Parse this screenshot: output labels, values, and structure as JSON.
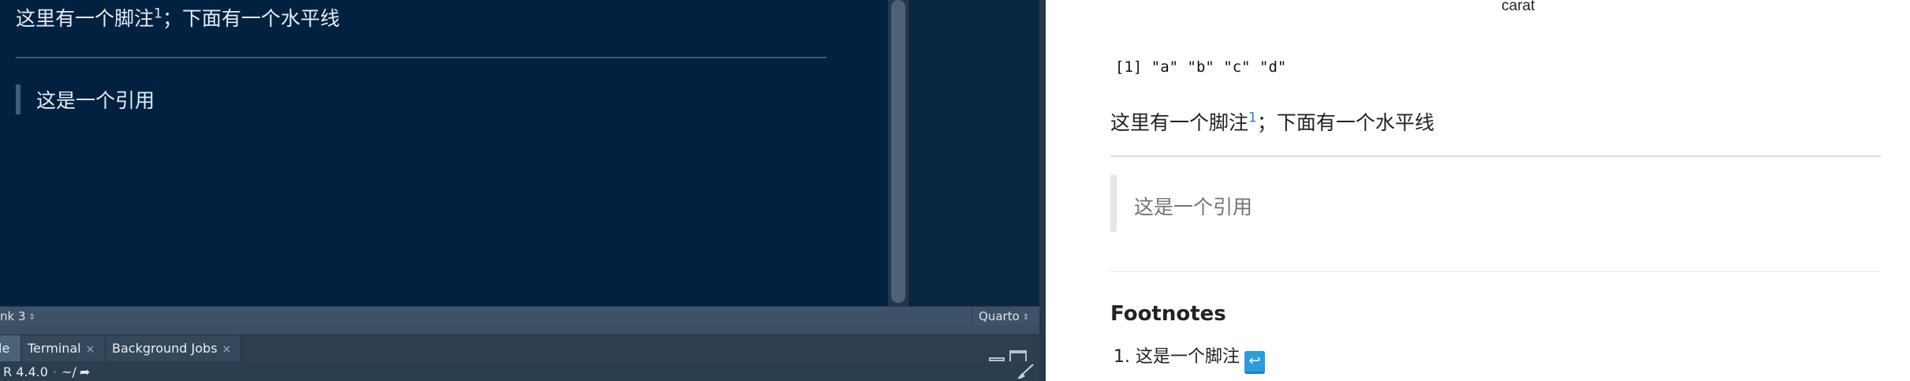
{
  "editor": {
    "line1_text": "这里有一个脚注",
    "line1_sup": "1",
    "line1_after": "；下面有一个水平线",
    "quote_text": "这是一个引用"
  },
  "statusbar": {
    "chunk_label": "nk 3",
    "chunk_updown": "⇕",
    "language": "Quarto",
    "language_updown": "⇕"
  },
  "lower_tabs": {
    "console_label": "le",
    "terminal_label": "Terminal",
    "bgjobs_label": "Background Jobs",
    "close_glyph": "×"
  },
  "console": {
    "r_version": "R 4.4.0",
    "separator": "·",
    "working_dir": "~/"
  },
  "viewer": {
    "carat_label": "carat",
    "code_output": "[1] \"a\" \"b\" \"c\" \"d\"",
    "para_text": "这里有一个脚注",
    "para_sup": "1",
    "para_after": "；下面有一个水平线",
    "quote_text": "这是一个引用",
    "footnotes_title": "Footnotes",
    "footnote_number": "1.",
    "footnote_text": "这是一个脚注",
    "backlink_glyph": "↩",
    "link_color": "#2a76dd"
  },
  "colors": {
    "editor_bg": "#002240",
    "statusbar_bg": "#3d5268",
    "viewer_bg": "#ffffff",
    "backlink_bg": "#2a9ddd"
  },
  "icons": {
    "minimize": "minimize-pane-icon",
    "maximize": "maximize-pane-icon",
    "share": "share-arrow-icon",
    "broom": "clear-console-broom-icon",
    "backlink": "return-arrow-icon"
  }
}
